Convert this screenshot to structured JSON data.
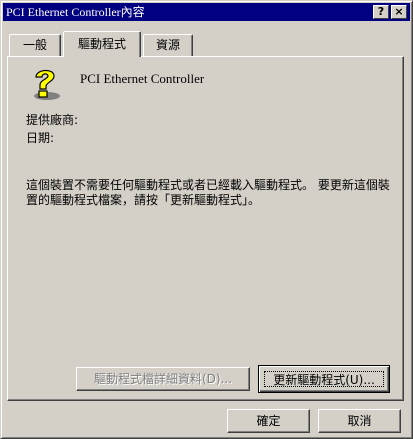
{
  "window": {
    "title": "PCI Ethernet Controller內容",
    "help_button": "?",
    "close_button": "×"
  },
  "tabs": [
    {
      "label": "一般",
      "selected": false
    },
    {
      "label": "驅動程式",
      "selected": true
    },
    {
      "label": "資源",
      "selected": false
    }
  ],
  "device": {
    "icon": "unknown-device-icon",
    "name": "PCI Ethernet Controller"
  },
  "fields": {
    "provider_label": "提供廠商:",
    "date_label": "日期:"
  },
  "description": "這個裝置不需要任何驅動程式或者已經載入驅動程式。 要更新這個裝置的驅動程式檔案，請按「更新驅動程式」。",
  "buttons": {
    "details": "驅動程式檔詳細資料(D)...",
    "details_enabled": false,
    "update": "更新驅動程式(U)...",
    "ok": "確定",
    "cancel": "取消"
  },
  "colors": {
    "titlebar": "#000080",
    "face": "#d4d0c8",
    "icon_yellow": "#ffff00"
  }
}
